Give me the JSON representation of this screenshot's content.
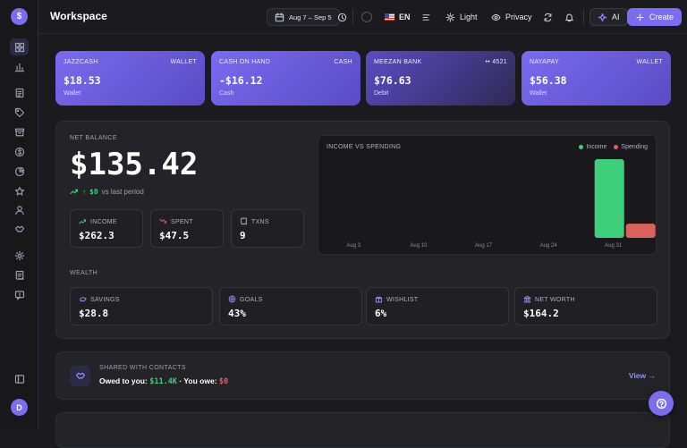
{
  "header": {
    "title": "Workspace",
    "date_range": "Aug 7 – Sep 5",
    "language": "EN",
    "theme_label": "Light",
    "privacy_label": "Privacy",
    "ai_label": "AI",
    "create_label": "Create"
  },
  "sidebar": {
    "logo_glyph": "$",
    "avatar_initial": "D",
    "icons": [
      "dashboard-icon",
      "bar-chart-icon",
      "document-icon",
      "tag-icon",
      "archive-icon",
      "dollar-icon",
      "pie-chart-icon",
      "star-icon",
      "user-icon",
      "handshake-icon",
      "settings-icon",
      "receipt-icon",
      "message-icon",
      "collapse-sidebar-icon"
    ]
  },
  "accounts": [
    {
      "name": "JAZZCASH",
      "right": "WALLET",
      "amount": "$18.53",
      "type": "Wallet"
    },
    {
      "name": "CASH ON HAND",
      "right": "CASH",
      "amount": "-$16.12",
      "type": "Cash"
    },
    {
      "name": "MEEZAN BANK",
      "right": "•• 4521",
      "amount": "$76.63",
      "type": "Debit"
    },
    {
      "name": "NAYAPAY",
      "right": "WALLET",
      "amount": "$56.38",
      "type": "Wallet"
    }
  ],
  "net": {
    "label": "NET BALANCE",
    "value": "$135.42",
    "delta": "$0",
    "delta_suffix": "vs last period"
  },
  "stats": [
    {
      "label": "INCOME",
      "value": "$262.3"
    },
    {
      "label": "SPENT",
      "value": "$47.5"
    },
    {
      "label": "TXNS",
      "value": "9"
    }
  ],
  "wealth": {
    "label": "WEALTH",
    "items": [
      {
        "label": "SAVINGS",
        "value": "$28.8"
      },
      {
        "label": "GOALS",
        "value": "43%"
      },
      {
        "label": "WISHLIST",
        "value": "6%"
      },
      {
        "label": "NET WORTH",
        "value": "$164.2"
      }
    ]
  },
  "shared": {
    "title": "SHARED WITH CONTACTS",
    "owed_label": "Owed to you:",
    "owed_value": "$11.4K",
    "sep": "·",
    "owe_label": "You owe:",
    "owe_value": "$0",
    "view_label": "View →"
  },
  "colors": {
    "accent": "#7c6cf0",
    "income": "#3ecf7a",
    "spending": "#d9625a"
  },
  "chart_data": {
    "type": "bar",
    "title": "INCOME VS SPENDING",
    "categories": [
      "Aug 3",
      "Aug 10",
      "Aug 17",
      "Aug 24",
      "Aug 31"
    ],
    "series": [
      {
        "name": "Income",
        "values": [
          0,
          0,
          0,
          0,
          262.3
        ]
      },
      {
        "name": "Spending",
        "values": [
          0,
          0,
          0,
          0,
          47.5
        ]
      }
    ],
    "ylim": [
      0,
      262.3
    ],
    "grid": false,
    "legend": "top-right"
  }
}
